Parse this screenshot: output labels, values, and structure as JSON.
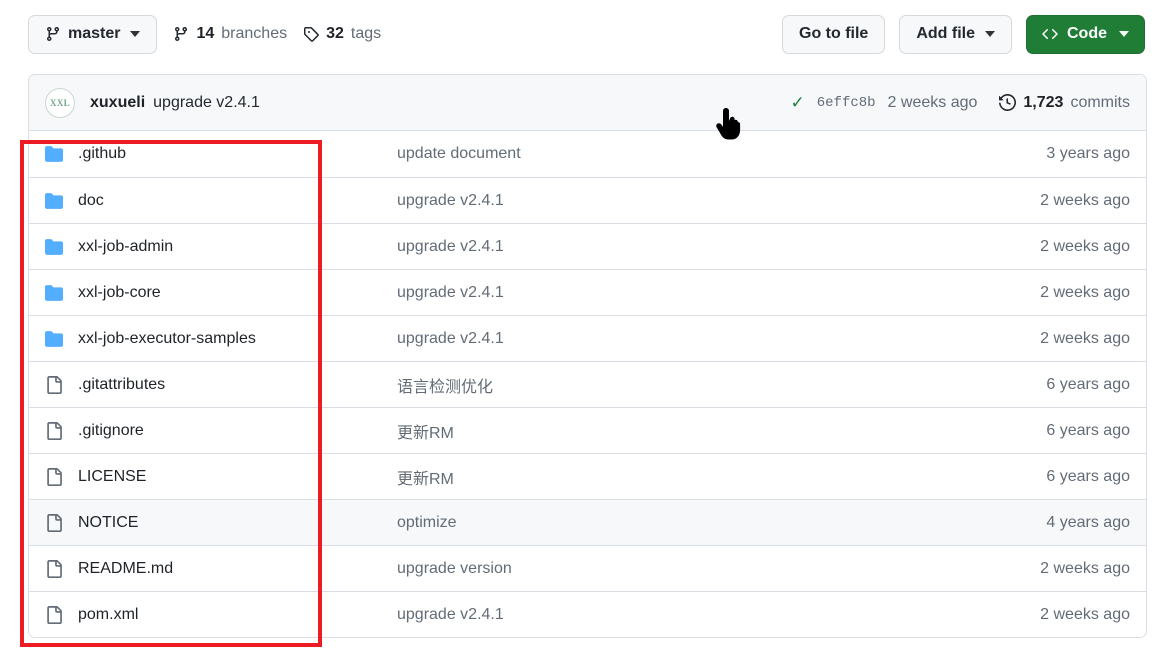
{
  "toolbar": {
    "branch_button": {
      "label": "master",
      "icon": "branch-icon"
    },
    "branches": {
      "count": "14",
      "label": "branches",
      "icon": "branch-icon"
    },
    "tags": {
      "count": "32",
      "label": "tags",
      "icon": "tag-icon"
    },
    "go_to_file": "Go to file",
    "add_file": "Add file",
    "code": "Code",
    "code_button_color": "#1f7d36"
  },
  "commit_header": {
    "avatar_text": "XXL",
    "author": "xuxueli",
    "message": "upgrade v2.4.1",
    "status_icon": "check-icon",
    "sha": "6effc8b",
    "time": "2 weeks ago",
    "commits_icon": "history-icon",
    "commits_count": "1,723",
    "commits_label": "commits"
  },
  "files": [
    {
      "icon": "folder-icon",
      "name": ".github",
      "message": "update document",
      "time": "3 years ago",
      "hovered": false
    },
    {
      "icon": "folder-icon",
      "name": "doc",
      "message": "upgrade v2.4.1",
      "time": "2 weeks ago",
      "hovered": false
    },
    {
      "icon": "folder-icon",
      "name": "xxl-job-admin",
      "message": "upgrade v2.4.1",
      "time": "2 weeks ago",
      "hovered": false
    },
    {
      "icon": "folder-icon",
      "name": "xxl-job-core",
      "message": "upgrade v2.4.1",
      "time": "2 weeks ago",
      "hovered": false
    },
    {
      "icon": "folder-icon",
      "name": "xxl-job-executor-samples",
      "message": "upgrade v2.4.1",
      "time": "2 weeks ago",
      "hovered": false
    },
    {
      "icon": "file-icon",
      "name": ".gitattributes",
      "message": "语言检测优化",
      "time": "6 years ago",
      "hovered": false
    },
    {
      "icon": "file-icon",
      "name": ".gitignore",
      "message": "更新RM",
      "time": "6 years ago",
      "hovered": false
    },
    {
      "icon": "file-icon",
      "name": "LICENSE",
      "message": "更新RM",
      "time": "6 years ago",
      "hovered": false
    },
    {
      "icon": "file-icon",
      "name": "NOTICE",
      "message": "optimize",
      "time": "4 years ago",
      "hovered": true
    },
    {
      "icon": "file-icon",
      "name": "README.md",
      "message": "upgrade version",
      "time": "2 weeks ago",
      "hovered": false
    },
    {
      "icon": "file-icon",
      "name": "pom.xml",
      "message": "upgrade v2.4.1",
      "time": "2 weeks ago",
      "hovered": false
    }
  ],
  "annotation": {
    "name": "red-highlight-box",
    "color": "#ed1c24"
  },
  "cursor": {
    "name": "pointer-hand-cursor"
  }
}
